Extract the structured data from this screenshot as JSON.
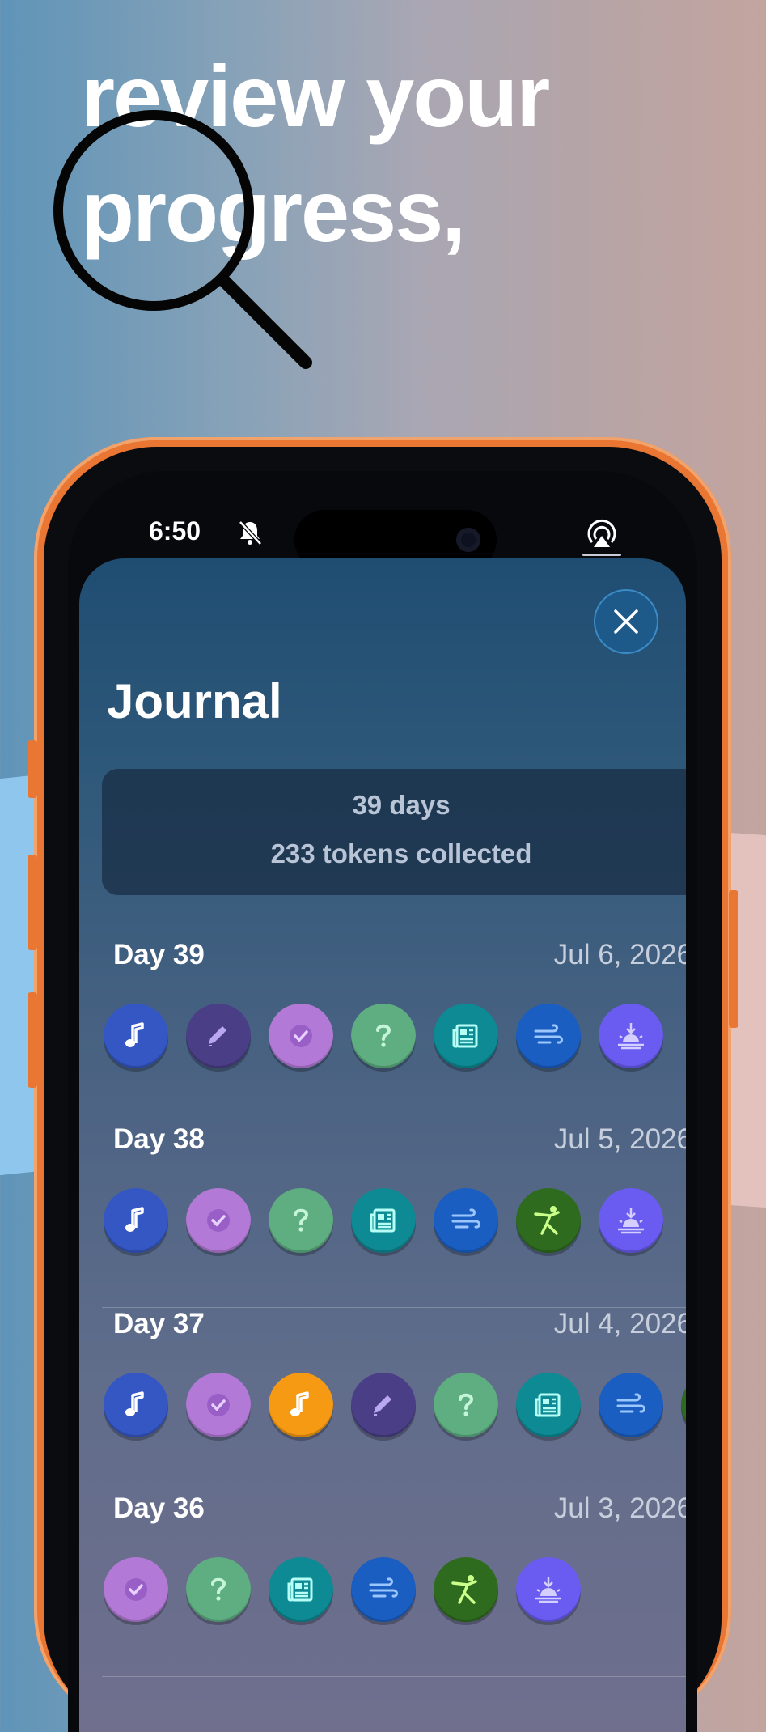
{
  "headline": {
    "line1": "review your",
    "line2": "progress,"
  },
  "status": {
    "time": "6:50"
  },
  "journal": {
    "title": "Journal",
    "summary": {
      "days": "39 days",
      "tokens": "233 tokens collected"
    }
  },
  "days": [
    {
      "title": "Day 39",
      "date": "Jul 6, 2026",
      "tokens": [
        "music-icon",
        "pencil-icon",
        "check-icon",
        "question-icon",
        "newspaper-icon",
        "wind-icon",
        "sunrise-icon"
      ]
    },
    {
      "title": "Day 38",
      "date": "Jul 5, 2026",
      "tokens": [
        "music-icon",
        "check-icon",
        "question-icon",
        "newspaper-icon",
        "wind-icon",
        "yoga-icon",
        "sunrise-icon"
      ]
    },
    {
      "title": "Day 37",
      "date": "Jul 4, 2026",
      "tokens": [
        "music-icon",
        "check-icon",
        "music-orange-icon",
        "pencil-icon",
        "question-icon",
        "newspaper-icon",
        "wind-icon",
        "yoga-icon"
      ]
    },
    {
      "title": "Day 36",
      "date": "Jul 3, 2026",
      "tokens": [
        "check-icon",
        "question-icon",
        "newspaper-icon",
        "wind-icon",
        "yoga-icon",
        "sunrise-icon"
      ]
    }
  ],
  "token_colors": {
    "music-icon": "#3557c4",
    "pencil-icon": "#4a3f86",
    "check-icon": "#b27ad6",
    "question-icon": "#5fae82",
    "newspaper-icon": "#0d8a93",
    "wind-icon": "#1a5ec2",
    "sunrise-icon": "#6a5cf0",
    "yoga-icon": "#2e6b1e",
    "music-orange-icon": "#f59a12"
  }
}
